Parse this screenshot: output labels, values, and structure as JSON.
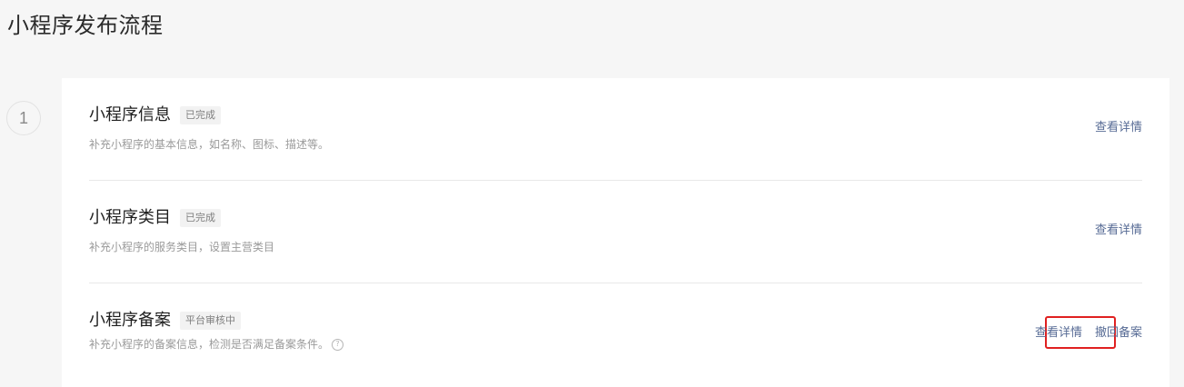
{
  "page": {
    "title": "小程序发布流程"
  },
  "step": {
    "number": "1"
  },
  "items": [
    {
      "title": "小程序信息",
      "badge": "已完成",
      "description": "补充小程序的基本信息，如名称、图标、描述等。",
      "actions": [
        {
          "label": "查看详情"
        }
      ]
    },
    {
      "title": "小程序类目",
      "badge": "已完成",
      "description": "补充小程序的服务类目，设置主营类目",
      "actions": [
        {
          "label": "查看详情"
        }
      ]
    },
    {
      "title": "小程序备案",
      "badge": "平台审核中",
      "description": "补充小程序的备案信息，检测是否满足备案条件。",
      "help_icon": "question-circle-icon",
      "actions": [
        {
          "label": "查看详情"
        },
        {
          "label": "撤回备案"
        }
      ]
    }
  ],
  "colors": {
    "link": "#576b95",
    "highlight_border": "#e02020",
    "background": "#f6f6f6",
    "card": "#ffffff"
  }
}
